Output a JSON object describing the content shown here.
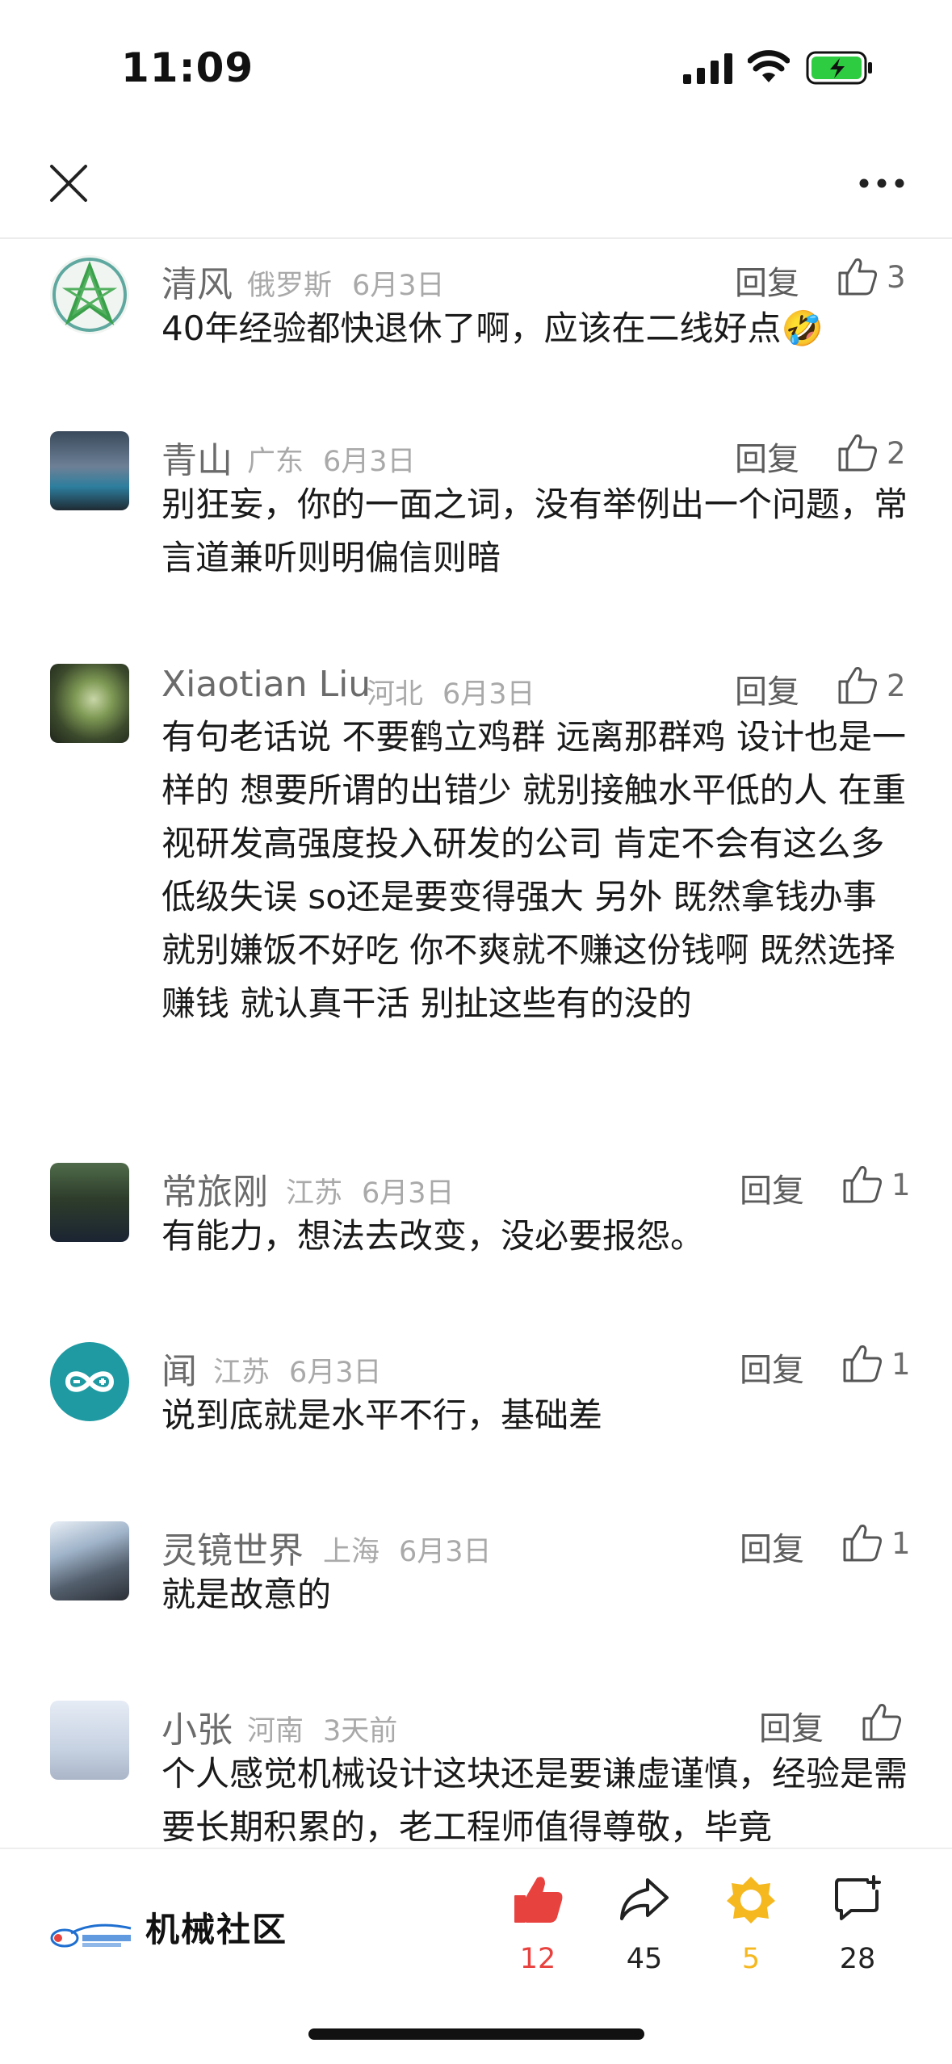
{
  "status_bar": {
    "time": "11:09"
  },
  "nav": {
    "close_icon": "close-icon",
    "more_icon": "more-horizontal-icon"
  },
  "comments": [
    {
      "name": "清风",
      "location": "俄罗斯",
      "date": "6月3日",
      "reply_label": "回复",
      "likes": "3",
      "text": "40年经验都快退休了啊，应该在二线好点🤣"
    },
    {
      "name": "青山",
      "location": "广东",
      "date": "6月3日",
      "reply_label": "回复",
      "likes": "2",
      "text": "别狂妄，你的一面之词，没有举例出一个问题，常言道兼听则明偏信则暗"
    },
    {
      "name": "Xiaotian Liu",
      "location": "河北",
      "date": "6月3日",
      "reply_label": "回复",
      "likes": "2",
      "text": "有句老话说 不要鹤立鸡群 远离那群鸡 设计也是一样的 想要所谓的出错少 就别接触水平低的人 在重视研发高强度投入研发的公司 肯定不会有这么多低级失误 so还是要变得强大 另外 既然拿钱办事 就别嫌饭不好吃 你不爽就不赚这份钱啊 既然选择赚钱 就认真干活 别扯这些有的没的"
    },
    {
      "name": "常旅刚",
      "location": "江苏",
      "date": "6月3日",
      "reply_label": "回复",
      "likes": "1",
      "text": "有能力，想法去改变，没必要报怨。"
    },
    {
      "name": "闻",
      "location": "江苏",
      "date": "6月3日",
      "reply_label": "回复",
      "likes": "1",
      "text": "说到底就是水平不行，基础差"
    },
    {
      "name": "灵镜世界",
      "location": "上海",
      "date": "6月3日",
      "reply_label": "回复",
      "likes": "1",
      "text": "就是故意的"
    },
    {
      "name": "小张",
      "location": "河南",
      "date": "3天前",
      "reply_label": "回复",
      "likes": "",
      "text": "个人感觉机械设计这块还是要谦虚谨慎，经验是需要长期积累的，老工程师值得尊敬，毕竟"
    }
  ],
  "bottom_bar": {
    "community_name": "机械社区",
    "like_count": "12",
    "share_count": "45",
    "favorite_count": "5",
    "comment_count": "28"
  },
  "colors": {
    "like_red": "#e8423f",
    "favorite_yellow": "#f5b81f",
    "battery_green": "#2ecc40"
  }
}
